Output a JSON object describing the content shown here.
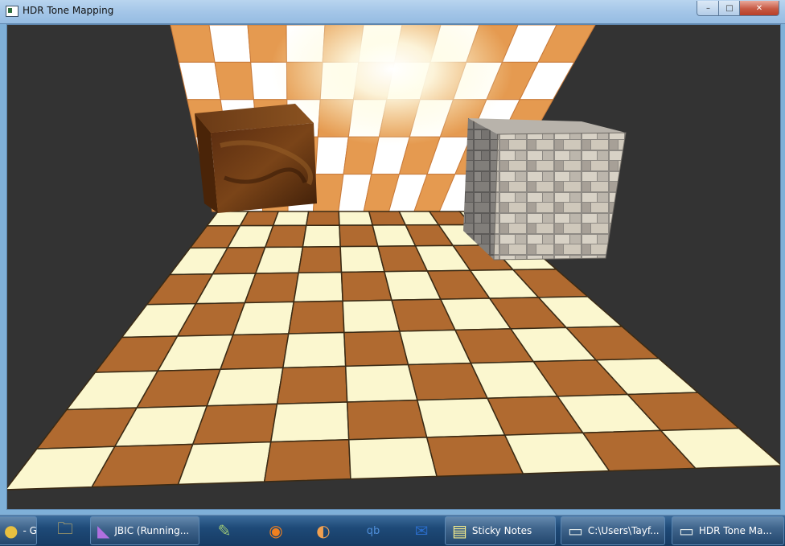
{
  "window": {
    "title": "HDR Tone Mapping"
  },
  "caption_buttons": {
    "minimize": "–",
    "maximize": "□",
    "close": "✕"
  },
  "taskbar": {
    "items": [
      {
        "label": "- Goo...",
        "icon": "chrome-icon"
      },
      {
        "label": "",
        "icon": "file-explorer-icon"
      },
      {
        "label": "JBIC (Running...",
        "icon": "visual-studio-icon"
      },
      {
        "label": "",
        "icon": "notepad-plus-plus-icon"
      },
      {
        "label": "",
        "icon": "blender-icon"
      },
      {
        "label": "",
        "icon": "orange-icon"
      },
      {
        "label": "",
        "icon": "qbittorrent-icon"
      },
      {
        "label": "",
        "icon": "outlook-icon"
      },
      {
        "label": "Sticky Notes",
        "icon": "sticky-notes-icon"
      },
      {
        "label": "C:\\Users\\Tayf...",
        "icon": "console-icon"
      },
      {
        "label": "HDR Tone Ma...",
        "icon": "app-window-icon"
      }
    ]
  },
  "colors": {
    "floor_light": "#fbf7cf",
    "floor_dark": "#b06a30",
    "wall_orange": "#e59a50",
    "wall_white": "#ffffff",
    "background": "#333333"
  }
}
